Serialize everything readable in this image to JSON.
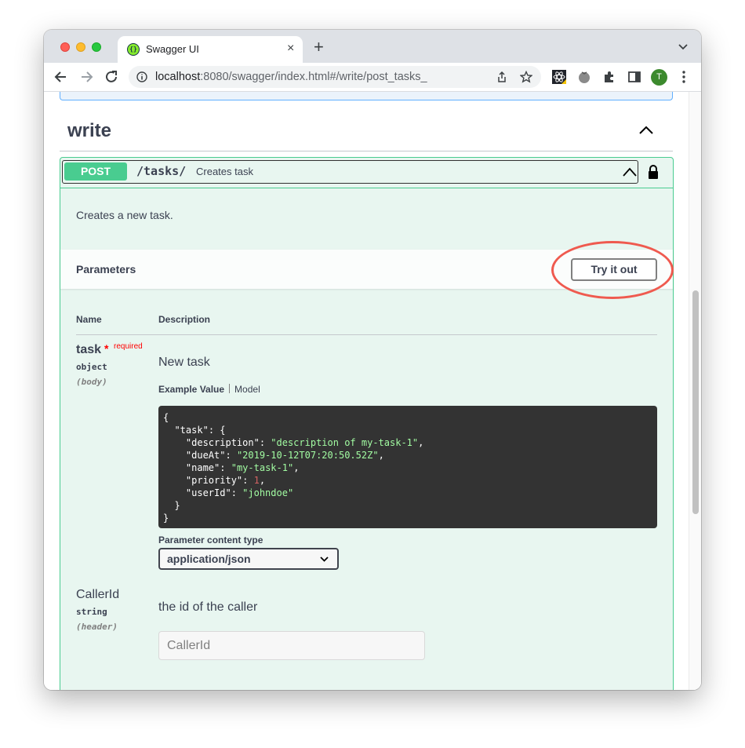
{
  "browser": {
    "tab_title": "Swagger UI",
    "tab_close": "×",
    "new_tab": "+",
    "url_host": "localhost",
    "url_rest": ":8080/swagger/index.html#/write/post_tasks_",
    "avatar_letter": "T"
  },
  "section": {
    "title": "write"
  },
  "operation": {
    "method": "POST",
    "path": "/tasks/",
    "summary": "Creates task",
    "description": "Creates a new task.",
    "accent_color": "#49cc90"
  },
  "parameters": {
    "title": "Parameters",
    "try_button": "Try it out",
    "col_name": "Name",
    "col_description": "Description",
    "items": [
      {
        "name": "task",
        "required_star": "*",
        "required_label": "required",
        "type": "object",
        "in": "(body)",
        "description": "New task",
        "example_tab": "Example Value",
        "model_tab": "Model",
        "content_type_label": "Parameter content type",
        "content_type": "application/json"
      },
      {
        "name": "CallerId",
        "type": "string",
        "in": "(header)",
        "description": "the id of the caller",
        "placeholder": "CallerId"
      }
    ]
  },
  "example": {
    "open": "{",
    "task_key": "\"task\"",
    "task_open": ": {",
    "fields": [
      {
        "key": "\"description\"",
        "value": "\"description of my-task-1\"",
        "kind": "str",
        "trail": ","
      },
      {
        "key": "\"dueAt\"",
        "value": "\"2019-10-12T07:20:50.52Z\"",
        "kind": "str",
        "trail": ","
      },
      {
        "key": "\"name\"",
        "value": "\"my-task-1\"",
        "kind": "str",
        "trail": ","
      },
      {
        "key": "\"priority\"",
        "value": "1",
        "kind": "num",
        "trail": ","
      },
      {
        "key": "\"userId\"",
        "value": "\"johndoe\"",
        "kind": "str",
        "trail": ""
      }
    ],
    "task_close": "}",
    "close": "}"
  }
}
